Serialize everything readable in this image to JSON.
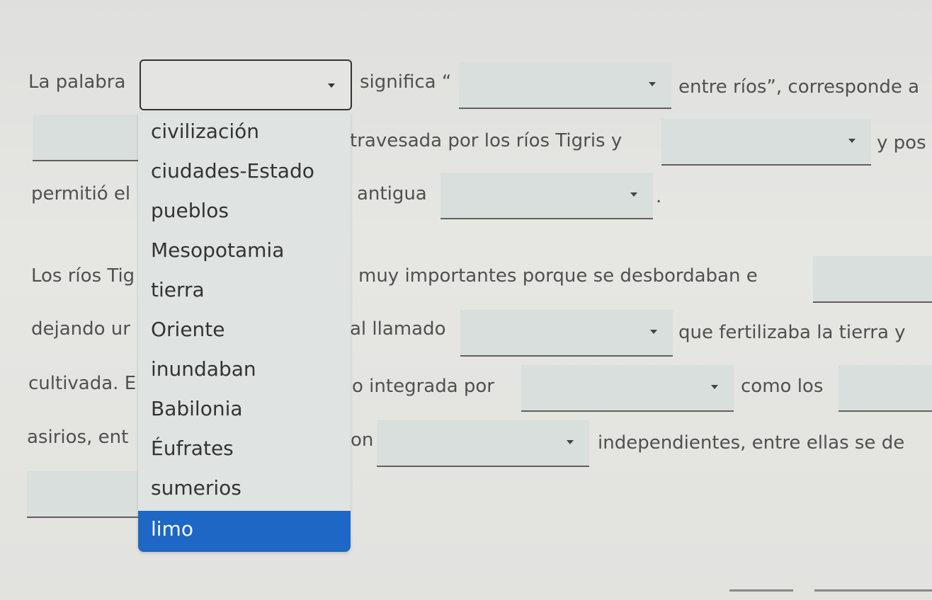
{
  "text": {
    "line1a": "La palabra",
    "line1b": "significa “",
    "line1c": "entre ríos”, corresponde a",
    "line2a": "travesada por los ríos Tigris y",
    "line2b": "y pos",
    "line3a": "permitió el",
    "line3b": "antigua",
    "line3c": ".",
    "line4a": "Los ríos Tig",
    "line4b": "muy importantes porque se desbordaban e",
    "line5a": "dejando ur",
    "line5b": "al llamado",
    "line5c": "que fertilizaba la tierra y",
    "line6a": "cultivada. E",
    "line6b": "o integrada por",
    "line6c": "como los",
    "line7a": "asirios, ent",
    "line7b": "on",
    "line7c": "independientes, entre ellas se de"
  },
  "dropdown": {
    "options": [
      "civilización",
      "ciudades-Estado",
      "pueblos",
      "Mesopotamia",
      "tierra",
      "Oriente",
      "inundaban",
      "Babilonia",
      "Éufrates",
      "sumerios",
      "limo"
    ],
    "selected_index": 10,
    "highlight_color": "#1e67c4"
  }
}
